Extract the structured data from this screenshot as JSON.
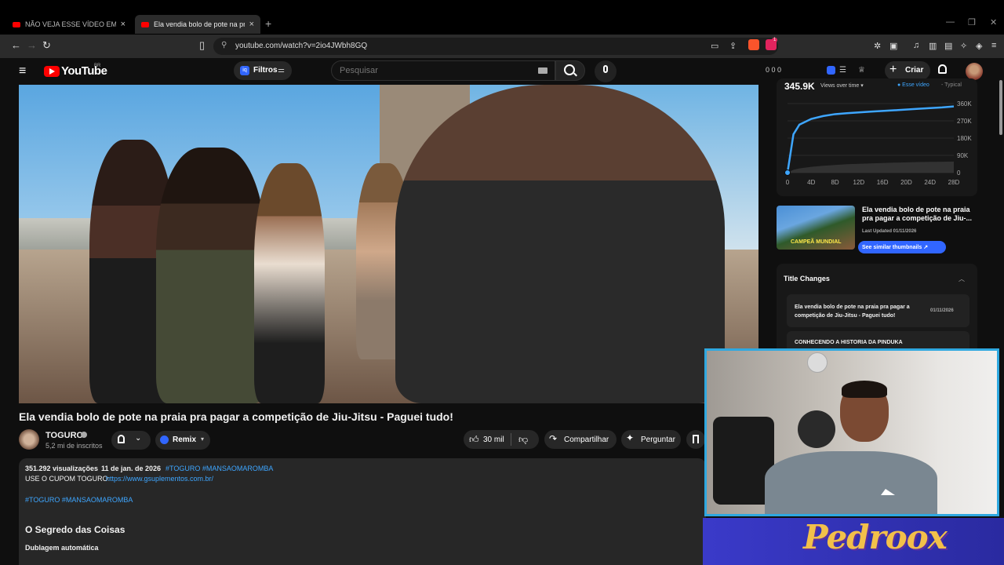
{
  "browser": {
    "tabs": [
      {
        "title": "NÃO VEJA ESSE VÍDEO EM PÚBLICO (",
        "active": false
      },
      {
        "title": "Ela vendia bolo de pote na praia",
        "active": true
      }
    ],
    "new_tab": "+",
    "url": "youtube.com/watch?v=2io4JWbh8GQ",
    "brave_badge": "1"
  },
  "youtube": {
    "logo_text": "YouTube",
    "region": "BR",
    "filters_label": "Filtros",
    "search_placeholder": "Pesquisar",
    "header_stats": "0  0  0",
    "create_label": "Criar"
  },
  "video": {
    "title": "Ela vendia bolo de pote na praia pra pagar a competição de Jiu-Jitsu - Paguei tudo!",
    "channel_name": "TOGURO",
    "subscribers": "5,2 mi de inscritos",
    "remix_label": "Remix",
    "likes": "30 mil",
    "share_label": "Compartilhar",
    "ask_label": "Perguntar"
  },
  "description": {
    "views": "351.292 visualizações",
    "date": "11 de jan. de 2026",
    "tags_top": "#TOGURO #MANSAOMAROMBA",
    "coupon_text": "USE O CUPOM TOGURO:",
    "coupon_link": "https://www.gsuplementos.com.br/",
    "tags_bottom": "#TOGURO #MANSAOMAROMBA",
    "heading": "O Segredo das Coisas",
    "dubbing": "Dublagem automática"
  },
  "side_panel": {
    "chart_headline": "345.9K",
    "chart_selector": "Views over time ▾",
    "legend_this": "● Esse vídeo",
    "legend_typical": "- Typical",
    "thumb_caption": "CAMPEÃ MUNDIAL",
    "thumb_title": "Ela vendia bolo de pote na praia pra pagar a competição de Jiu-...",
    "last_updated": "Last Updated 01/11/2026",
    "similar_btn": "See similar thumbnails ↗",
    "title_changes_heading": "Title Changes",
    "title_change_1": "Ela vendia bolo de pote na praia pra pagar a competição de Jiu-Jitsu - Paguei tudo!",
    "title_change_1_date": "01/11/2026",
    "title_change_2": "CONHECENDO A HISTORIA DA PINDUKA"
  },
  "overlay": {
    "banner_text": "Pedroox"
  },
  "chart_data": {
    "type": "line",
    "title": "345.9K",
    "x": [
      "0",
      "4D",
      "8D",
      "12D",
      "16D",
      "20D",
      "24D",
      "28D"
    ],
    "x_values": [
      0,
      1,
      2,
      4,
      6,
      8,
      10,
      14,
      18,
      22,
      26,
      28
    ],
    "series": [
      {
        "name": "Esse vídeo",
        "values": [
          0,
          200,
          250,
          280,
          295,
          305,
          310,
          318,
          325,
          333,
          340,
          345
        ],
        "color": "#3ea6ff"
      },
      {
        "name": "Typical",
        "values": [
          0,
          15,
          22,
          30,
          36,
          40,
          44,
          48,
          52,
          55,
          57,
          58
        ],
        "color": "#555555"
      }
    ],
    "y_ticks": [
      "360K",
      "270K",
      "180K",
      "90K",
      "0"
    ],
    "ylim": [
      0,
      360
    ],
    "xlim": [
      0,
      28
    ],
    "grid": true
  },
  "colors": {
    "accent": "#3ea6ff",
    "brand": "#ff0000",
    "cam_border": "#2fa8e0"
  }
}
